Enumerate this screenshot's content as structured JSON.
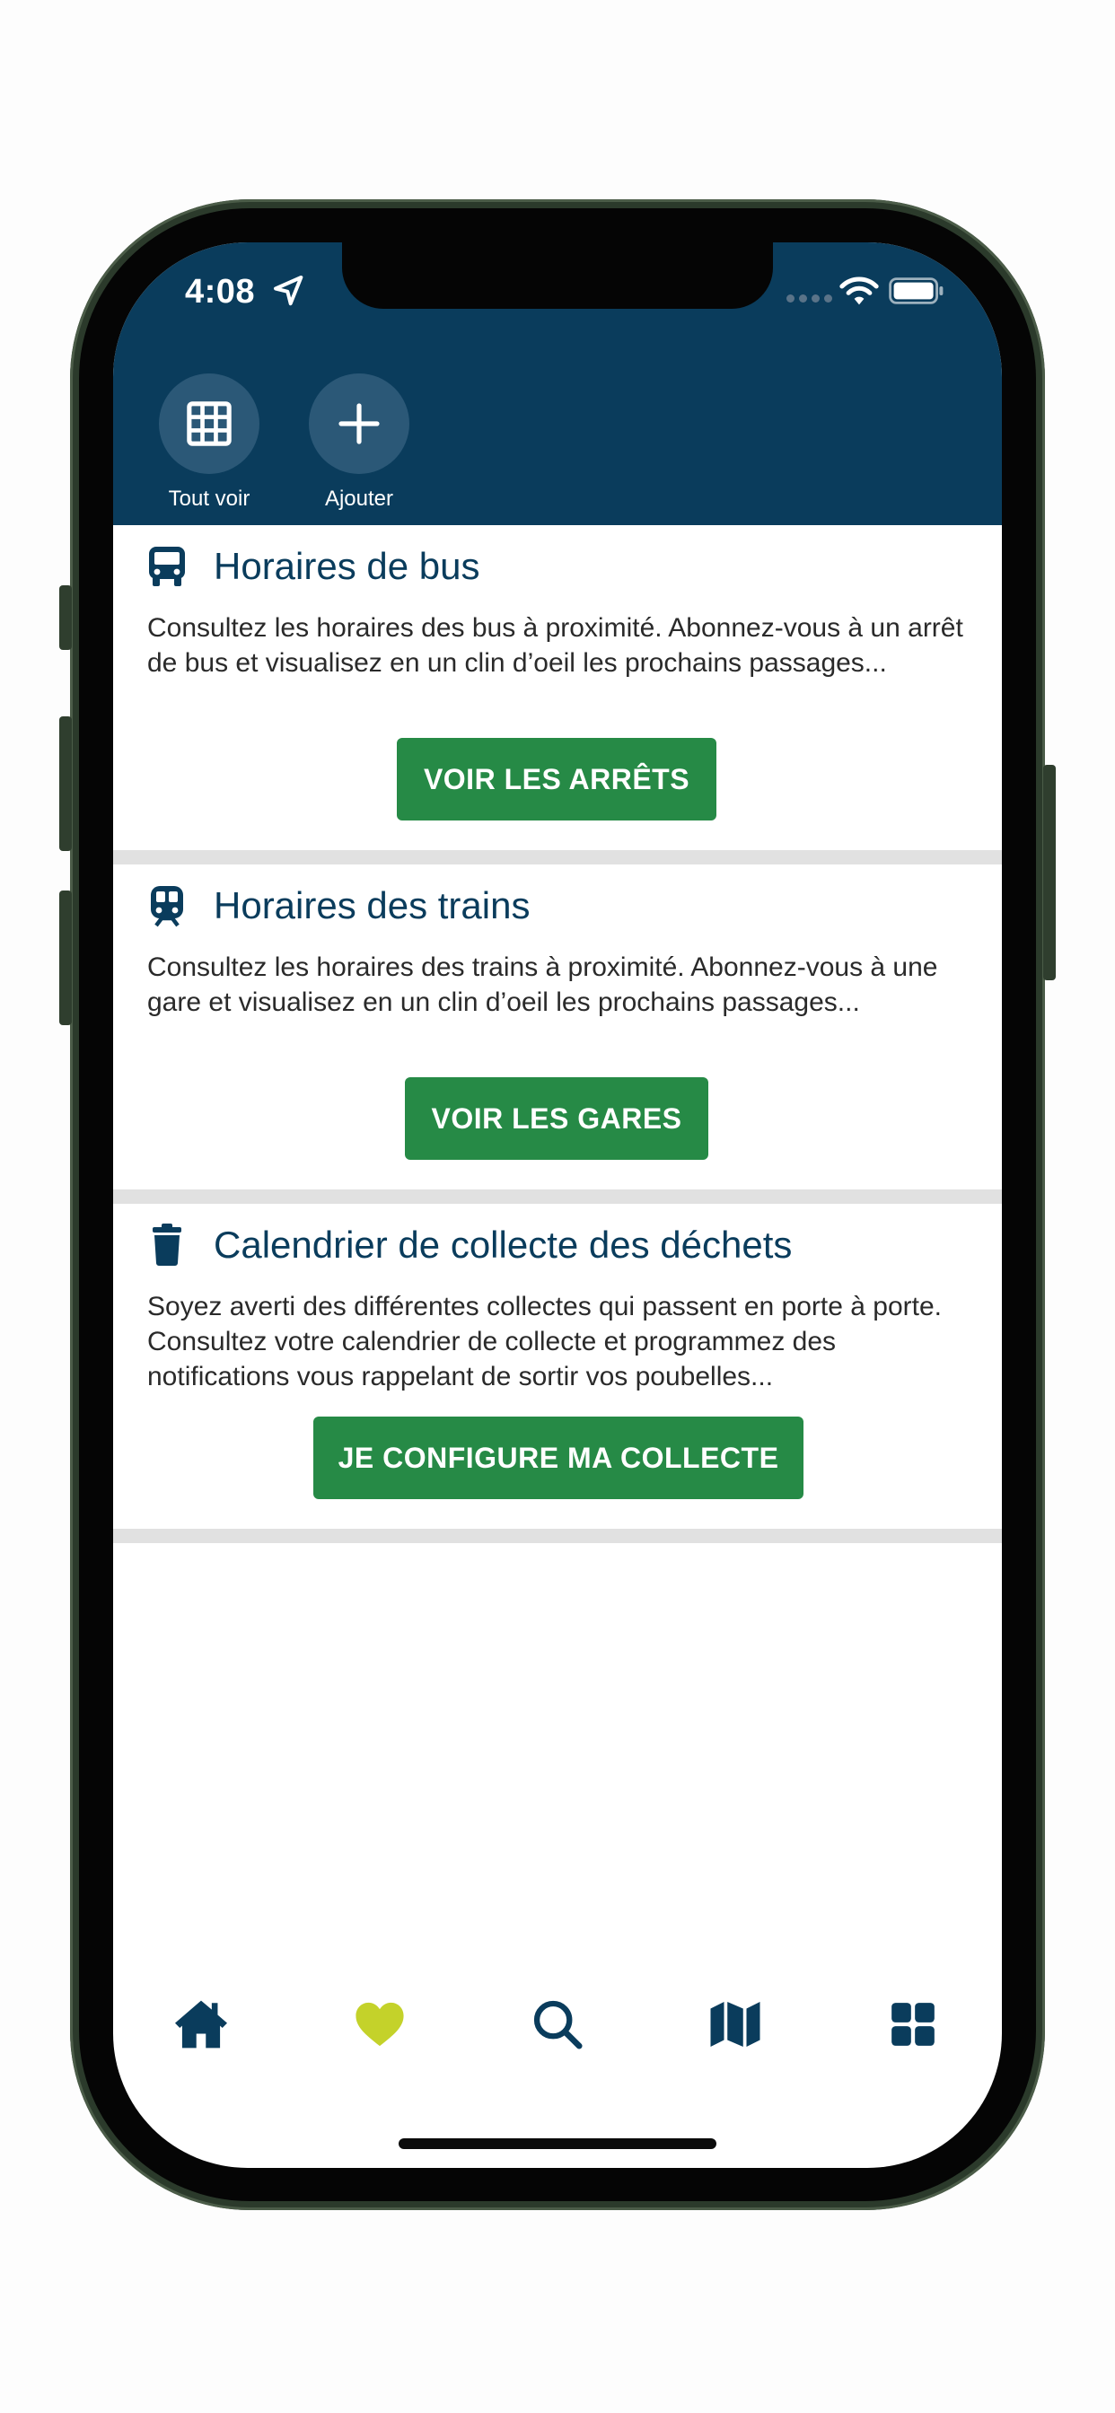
{
  "status_bar": {
    "time": "4:08"
  },
  "quick_actions": [
    {
      "label": "Tout voir",
      "icon": "grid-icon"
    },
    {
      "label": "Ajouter",
      "icon": "plus-icon"
    }
  ],
  "cards": [
    {
      "icon": "bus-icon",
      "title": "Horaires de bus",
      "description": "Consultez les horaires des bus à proximité. Abonnez-vous à un arrêt de bus et visualisez en un clin d’oeil les prochains passages...",
      "button": "VOIR LES ARRÊTS"
    },
    {
      "icon": "train-icon",
      "title": "Horaires des trains",
      "description": "Consultez les horaires des trains à proximité. Abonnez-vous à une gare et visualisez en un clin d’oeil les prochains passages...",
      "button": "VOIR LES GARES"
    },
    {
      "icon": "trash-icon",
      "title": "Calendrier de collecte des déchets",
      "description": "Soyez averti des différentes collectes qui passent en porte à porte. Consultez votre calendrier de collecte et programmez des notifications vous rappelant de sortir vos poubelles...",
      "button": "JE CONFIGURE MA COLLECTE"
    }
  ],
  "tab_bar": [
    {
      "icon": "home-icon",
      "active": false
    },
    {
      "icon": "heart-icon",
      "active": true
    },
    {
      "icon": "search-icon",
      "active": false
    },
    {
      "icon": "map-icon",
      "active": false
    },
    {
      "icon": "apps-grid-icon",
      "active": false
    }
  ],
  "colors": {
    "header": "#0a3c5c",
    "primary_text": "#0a3c5c",
    "button": "#268a46",
    "active_tab": "#c4d22a"
  }
}
